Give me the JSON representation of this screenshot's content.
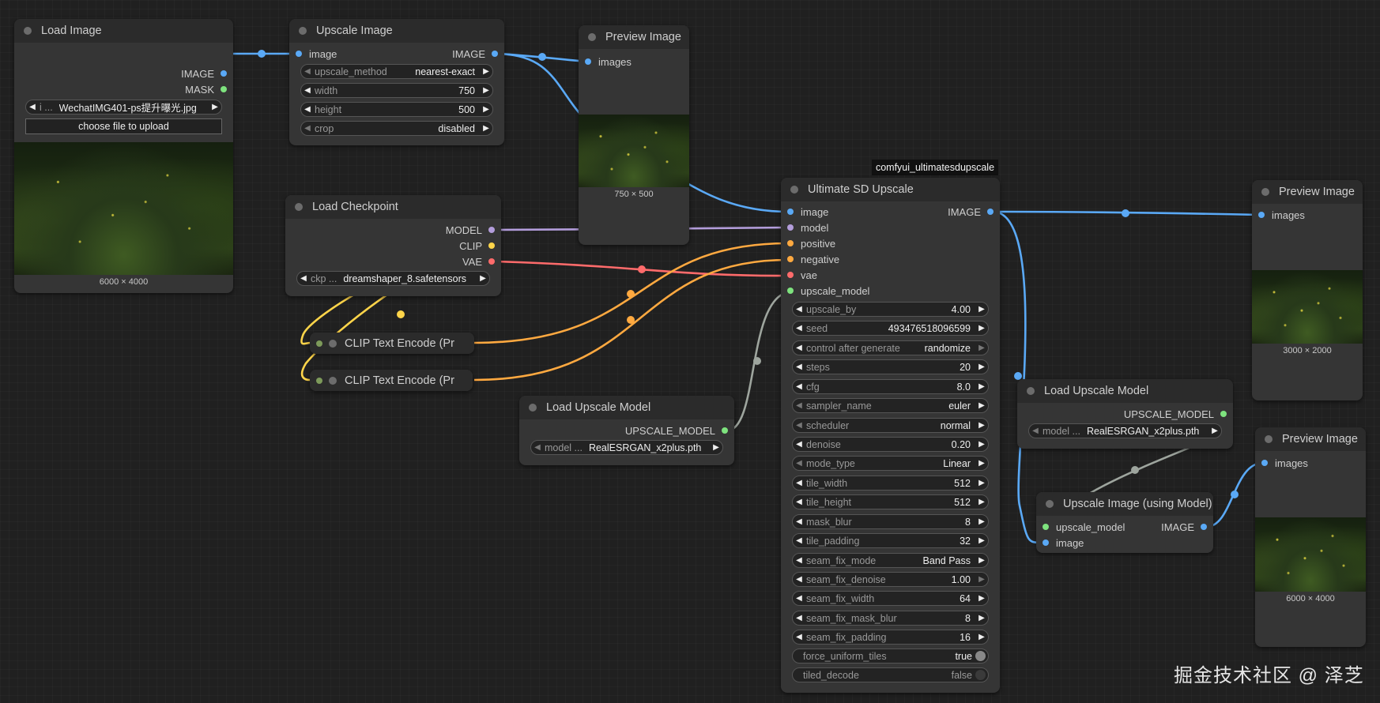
{
  "colors": {
    "image": "#5aa9f6",
    "model": "#b39ddb",
    "clip": "#ffd54a",
    "vae": "#ff6b6b",
    "conditioning": "#ffa940",
    "upscale_model": "#7ee37e",
    "canvas": "#202020",
    "node": "#353535"
  },
  "load_image": {
    "title": "Load Image",
    "outputs": [
      "IMAGE",
      "MASK"
    ],
    "image_label": "i ...",
    "image_value": "WechatIMG401-ps提升曝光.jpg",
    "upload_label": "choose file to upload",
    "dims": "6000 × 4000"
  },
  "upscale_image": {
    "title": "Upscale Image",
    "input": "image",
    "output": "IMAGE",
    "widgets": [
      {
        "label": "upscale_method",
        "value": "nearest-exact"
      },
      {
        "label": "width",
        "value": "750"
      },
      {
        "label": "height",
        "value": "500"
      },
      {
        "label": "crop",
        "value": "disabled"
      }
    ]
  },
  "preview1": {
    "title": "Preview Image",
    "input": "images",
    "dims": "750 × 500"
  },
  "load_checkpoint": {
    "title": "Load Checkpoint",
    "outputs": [
      "MODEL",
      "CLIP",
      "VAE"
    ],
    "ckpt_label": "ckp ...",
    "ckpt_value": "dreamshaper_8.safetensors"
  },
  "clip1": {
    "title": "CLIP Text Encode (Pr"
  },
  "clip2": {
    "title": "CLIP Text Encode (Pr"
  },
  "load_upscale_model1": {
    "title": "Load Upscale Model",
    "output": "UPSCALE_MODEL",
    "label": "model ...",
    "value": "RealESRGAN_x2plus.pth"
  },
  "group_label": "comfyui_ultimatesdupscale",
  "usd": {
    "title": "Ultimate SD Upscale",
    "inputs": [
      "image",
      "model",
      "positive",
      "negative",
      "vae",
      "upscale_model"
    ],
    "output": "IMAGE",
    "widgets": [
      {
        "label": "upscale_by",
        "value": "4.00"
      },
      {
        "label": "seed",
        "value": "493476518096599"
      },
      {
        "label": "control after generate",
        "value": "randomize"
      },
      {
        "label": "steps",
        "value": "20"
      },
      {
        "label": "cfg",
        "value": "8.0"
      },
      {
        "label": "sampler_name",
        "value": "euler"
      },
      {
        "label": "scheduler",
        "value": "normal"
      },
      {
        "label": "denoise",
        "value": "0.20"
      },
      {
        "label": "mode_type",
        "value": "Linear"
      },
      {
        "label": "tile_width",
        "value": "512"
      },
      {
        "label": "tile_height",
        "value": "512"
      },
      {
        "label": "mask_blur",
        "value": "8"
      },
      {
        "label": "tile_padding",
        "value": "32"
      },
      {
        "label": "seam_fix_mode",
        "value": "Band Pass"
      },
      {
        "label": "seam_fix_denoise",
        "value": "1.00"
      },
      {
        "label": "seam_fix_width",
        "value": "64"
      },
      {
        "label": "seam_fix_mask_blur",
        "value": "8"
      },
      {
        "label": "seam_fix_padding",
        "value": "16"
      }
    ],
    "toggles": [
      {
        "label": "force_uniform_tiles",
        "value": "true"
      },
      {
        "label": "tiled_decode",
        "value": "false"
      }
    ]
  },
  "preview2": {
    "title": "Preview Image",
    "input": "images",
    "dims": "3000 × 2000"
  },
  "load_upscale_model2": {
    "title": "Load Upscale Model",
    "output": "UPSCALE_MODEL",
    "label": "model ...",
    "value": "RealESRGAN_x2plus.pth"
  },
  "upscale_with_model": {
    "title": "Upscale Image (using Model)",
    "inputs": [
      "upscale_model",
      "image"
    ],
    "output": "IMAGE"
  },
  "preview3": {
    "title": "Preview Image",
    "input": "images",
    "dims": "6000 × 4000"
  },
  "watermark": "掘金技术社区 @ 泽芝"
}
